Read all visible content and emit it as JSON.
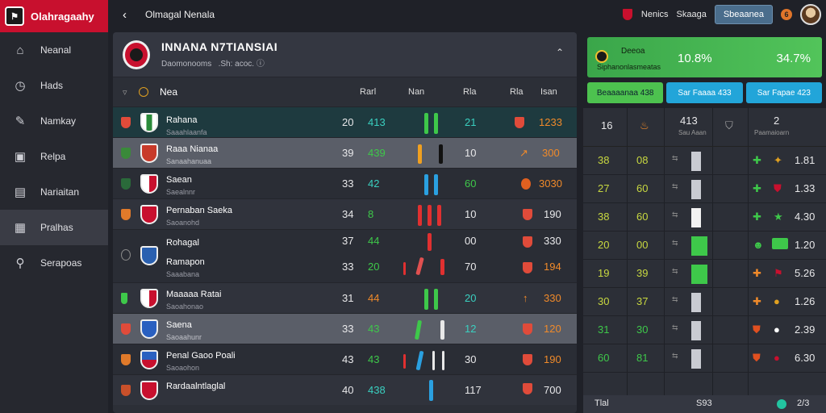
{
  "app": {
    "name": "Olahragaahy"
  },
  "topbar": {
    "title": "Olmagal Nenala",
    "link1": "Nenics",
    "link2": "Skaaga",
    "button": "Sbeaanea",
    "coin": "6"
  },
  "sidebar": {
    "items": [
      {
        "label": "Neanal",
        "icon": "home-icon"
      },
      {
        "label": "Hads",
        "icon": "clock-icon"
      },
      {
        "label": "Namkay",
        "icon": "tag-icon"
      },
      {
        "label": "Relpa",
        "icon": "briefcase-icon"
      },
      {
        "label": "Nariaitan",
        "icon": "calendar-icon"
      },
      {
        "label": "Pralhas",
        "icon": "grid-icon"
      },
      {
        "label": "Serapoas",
        "icon": "search-icon"
      }
    ]
  },
  "club": {
    "name": "INNANA N7TIANSIAI",
    "subtitle": "Daomonooms   .Sh: acoc."
  },
  "table": {
    "headers": {
      "team": "Nea",
      "c1": "Rarl",
      "c2": "Nan",
      "c3": "Rla",
      "c4": "Rla",
      "c5": "Isan"
    },
    "rows": [
      {
        "name": "Rahana",
        "sub": "Saaahlaanfa",
        "v1": "20",
        "v2": "413",
        "v3": "21",
        "v4": "1233"
      },
      {
        "name": "Raaa Nianaa",
        "sub": "Sanaahanuaa",
        "v1": "39",
        "v2": "439",
        "v3": "10",
        "v4": "300"
      },
      {
        "name": "Saean",
        "sub": "Saealnnr",
        "v1": "33",
        "v2": "42",
        "v3": "60",
        "v4": "3030"
      },
      {
        "name": "Pernaban Saeka",
        "sub": "Saoanohd",
        "v1": "34",
        "v2": "8",
        "v3": "10",
        "v4": "190"
      },
      {
        "name": "Rohagal",
        "sub": "",
        "v1": "37",
        "v2": "44",
        "v3": "00",
        "v4": "330"
      },
      {
        "name": "Ramapon",
        "sub": "Saaabana",
        "v1": "33",
        "v2": "20",
        "v3": "70",
        "v4": "194"
      },
      {
        "name": "Maaaaa Ratai",
        "sub": "Saoahonao",
        "v1": "31",
        "v2": "44",
        "v3": "20",
        "v4": "330"
      },
      {
        "name": "Saena",
        "sub": "Saoaahunr",
        "v1": "33",
        "v2": "43",
        "v3": "12",
        "v4": "120"
      },
      {
        "name": "Penal Gaoo Poali",
        "sub": "Saoaohon",
        "v1": "43",
        "v2": "43",
        "v3": "30",
        "v4": "190"
      },
      {
        "name": "Rardaalntlaglal",
        "sub": "",
        "v1": "40",
        "v2": "438",
        "v3": "117",
        "v4": "700"
      }
    ]
  },
  "promo": {
    "t1": "Deeoa",
    "t2": "Siphanonlasmeatas",
    "v1": "10.8%",
    "v2": "34.7%"
  },
  "tabs": [
    "Beaaaanaa 438",
    "Sar Faaaa 433",
    "Sar Fapae 423"
  ],
  "stats": {
    "head": {
      "h1": "16",
      "h3": "413",
      "h3sub": "Sau Aaan",
      "h5": "2",
      "h5sub": "Paamaioarn"
    },
    "rows": [
      {
        "a": "38",
        "b": "08",
        "v": "1.81"
      },
      {
        "a": "27",
        "b": "60",
        "v": "1.33"
      },
      {
        "a": "38",
        "b": "60",
        "v": "4.30"
      },
      {
        "a": "20",
        "b": "00",
        "v": "1.20"
      },
      {
        "a": "19",
        "b": "39",
        "v": "5.26"
      },
      {
        "a": "30",
        "b": "37",
        "v": "1.26"
      },
      {
        "a": "31",
        "b": "30",
        "v": "2.39"
      },
      {
        "a": "60",
        "b": "81",
        "v": "6.30"
      }
    ],
    "footer": {
      "left": "Tlal",
      "mid": "S93",
      "right": " 2/3"
    }
  },
  "colors": {
    "accent": "#c8102e",
    "green": "#4dc24f",
    "blue": "#22a5d9",
    "orange": "#f08a2a"
  }
}
